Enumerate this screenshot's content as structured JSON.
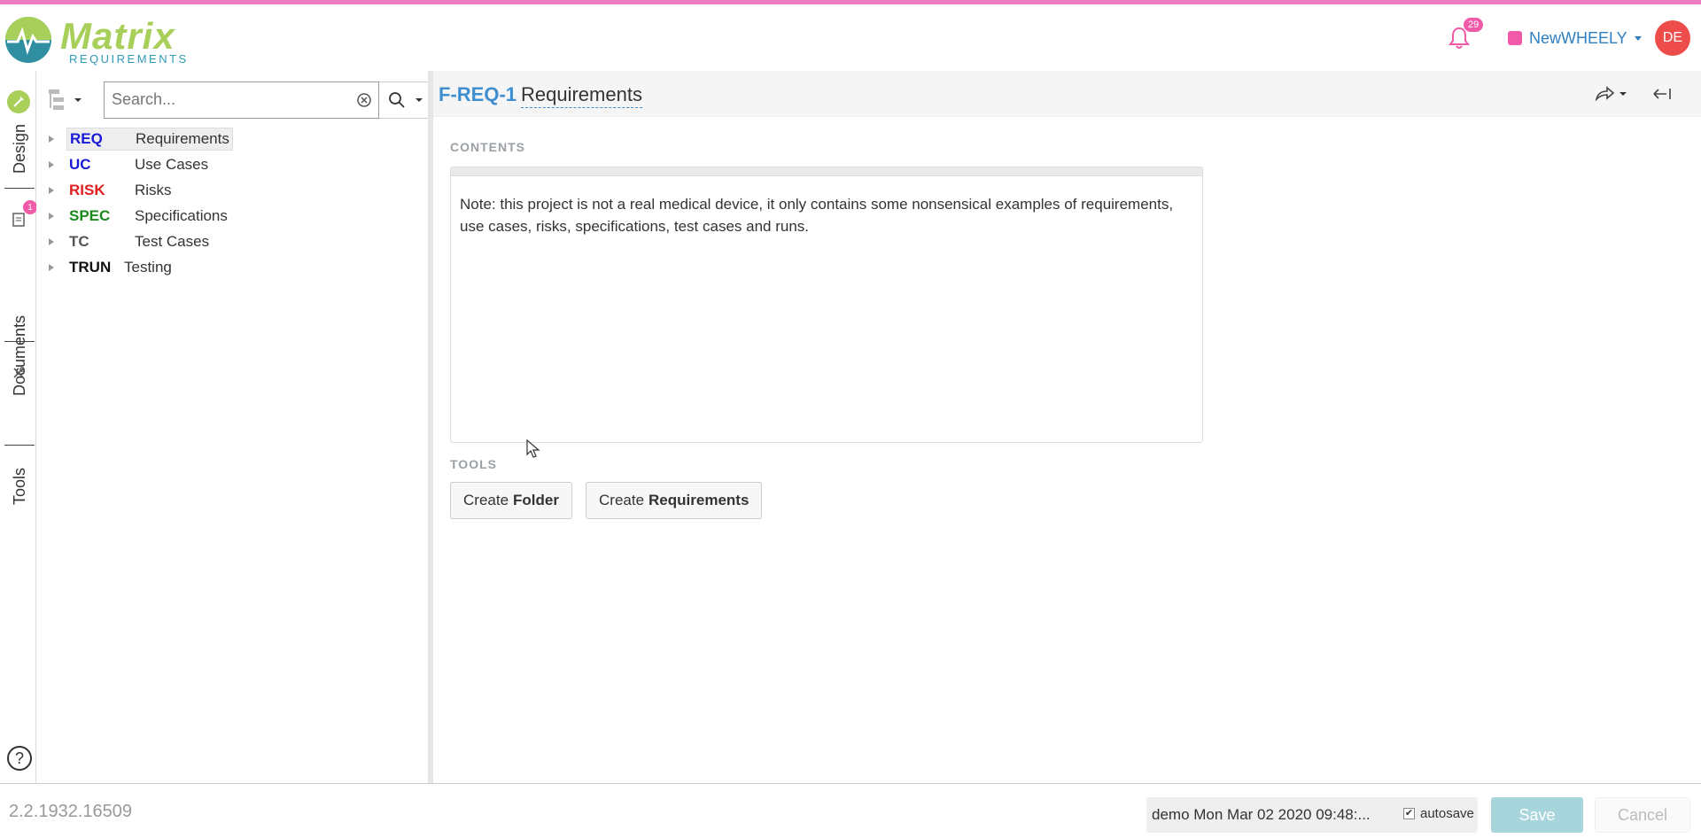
{
  "header": {
    "logo_word": "Matrix",
    "logo_sub": "REQUIREMENTS",
    "notification_count": "29",
    "project_name": "NewWHEELY",
    "avatar_initials": "DE"
  },
  "sidebar": {
    "tabs": [
      {
        "label": "Design"
      },
      {
        "label": "Documents",
        "badge": "1"
      },
      {
        "label": "Tools"
      }
    ],
    "help_label": "?"
  },
  "tree": {
    "search_placeholder": "Search...",
    "items": [
      {
        "code": "REQ",
        "label": "Requirements",
        "color": "#1a1ad6",
        "selected": true
      },
      {
        "code": "UC",
        "label": "Use Cases",
        "color": "#1a1ad6"
      },
      {
        "code": "RISK",
        "label": "Risks",
        "color": "#e02020"
      },
      {
        "code": "SPEC",
        "label": "Specifications",
        "color": "#1a8a1a"
      },
      {
        "code": "TC",
        "label": "Test Cases",
        "color": "#555555"
      },
      {
        "code": "TRUN",
        "label": "Testing",
        "color": "#111111"
      }
    ]
  },
  "main": {
    "item_id": "F-REQ-1",
    "item_title": "Requirements",
    "contents_label": "CONTENTS",
    "contents_text": "Note: this project is not a real medical device, it only contains some nonsensical examples of requirements, use cases, risks, specifications, test cases and runs.",
    "tools_label": "TOOLS",
    "tools": [
      {
        "prefix": "Create",
        "bold": "Folder"
      },
      {
        "prefix": "Create",
        "bold": "Requirements"
      }
    ]
  },
  "footer": {
    "version": "2.2.1932.16509",
    "status": "demo Mon Mar 02 2020 09:48:...",
    "autosave_label": "autosave",
    "autosave_checked": true,
    "save_label": "Save",
    "cancel_label": "Cancel"
  },
  "colors": {
    "accent_pink": "#f07cc2",
    "brand_green": "#a8cf5a",
    "link_blue": "#3f8fd0"
  }
}
